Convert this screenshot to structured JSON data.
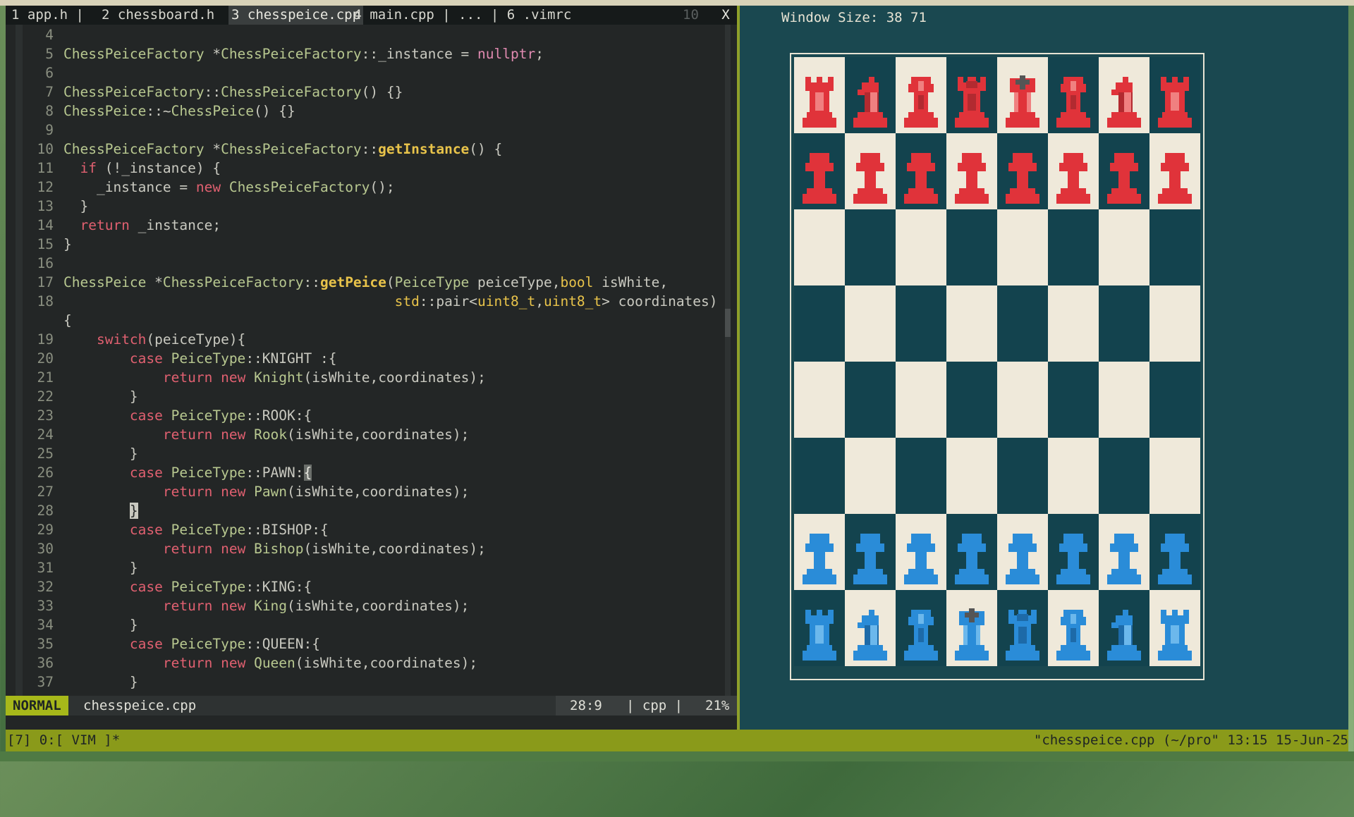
{
  "tabs": [
    {
      "label": "1 app.h | ",
      "active": false
    },
    {
      "label": "2 chessboard.h ",
      "active": false
    },
    {
      "label": "3 chesspeice.cpp",
      "active": true
    },
    {
      "label": " 4 main.cpp | ... | 6 .vimrc",
      "active": false
    }
  ],
  "tab_count": "10",
  "tab_close": "X",
  "editor": {
    "lines": [
      {
        "n": "4",
        "html": ""
      },
      {
        "n": "5",
        "html": "<span class=\"ty\">ChessPeiceFactory</span> *<span class=\"ty\">ChessPeiceFactory</span>::_instance = <span class=\"nu\">nullptr</span>;"
      },
      {
        "n": "6",
        "html": ""
      },
      {
        "n": "7",
        "html": "<span class=\"ty\">ChessPeiceFactory</span>::<span class=\"ty\">ChessPeiceFactory</span>() {}"
      },
      {
        "n": "8",
        "html": "<span class=\"ty\">ChessPeice</span>::~<span class=\"ty\">ChessPeice</span>() {}"
      },
      {
        "n": "9",
        "html": ""
      },
      {
        "n": "10",
        "html": "<span class=\"ty\">ChessPeiceFactory</span> *<span class=\"ty\">ChessPeiceFactory</span>::<span class=\"fn\">getInstance</span>() {"
      },
      {
        "n": "11",
        "html": "  <span class=\"kw\">if</span> (!_instance) {"
      },
      {
        "n": "12",
        "html": "    _instance = <span class=\"kw\">new</span> <span class=\"ty\">ChessPeiceFactory</span>();"
      },
      {
        "n": "13",
        "html": "  }"
      },
      {
        "n": "14",
        "html": "  <span class=\"kw\">return</span> _instance;"
      },
      {
        "n": "15",
        "html": "}"
      },
      {
        "n": "16",
        "html": ""
      },
      {
        "n": "17",
        "html": "<span class=\"ty\">ChessPeice</span> *<span class=\"ty\">ChessPeiceFactory</span>::<span class=\"fn\">getPeice</span>(<span class=\"ty\">PeiceType</span> peiceType,<span class=\"br\">bool</span> isWhite,"
      },
      {
        "n": "18",
        "html": "                                        <span class=\"br\">std</span>::pair&lt;<span class=\"br\">uint8_t</span>,<span class=\"br\">uint8_t</span>&gt; coordinates)"
      },
      {
        "n": "",
        "html": "{"
      },
      {
        "n": "19",
        "html": "    <span class=\"kw\">switch</span>(peiceType){"
      },
      {
        "n": "20",
        "html": "        <span class=\"kw\">case</span> <span class=\"ty\">PeiceType</span>::KNIGHT :{"
      },
      {
        "n": "21",
        "html": "            <span class=\"kw\">return</span> <span class=\"kw\">new</span> <span class=\"ty\">Knight</span>(isWhite,coordinates);"
      },
      {
        "n": "22",
        "html": "        }"
      },
      {
        "n": "23",
        "html": "        <span class=\"kw\">case</span> <span class=\"ty\">PeiceType</span>::ROOK:{"
      },
      {
        "n": "24",
        "html": "            <span class=\"kw\">return</span> <span class=\"kw\">new</span> <span class=\"ty\">Rook</span>(isWhite,coordinates);"
      },
      {
        "n": "25",
        "html": "        }"
      },
      {
        "n": "26",
        "html": "        <span class=\"kw\">case</span> <span class=\"ty\">PeiceType</span>::PAWN:<span class=\"cur2\">{</span>"
      },
      {
        "n": "27",
        "html": "            <span class=\"kw\">return</span> <span class=\"kw\">new</span> <span class=\"ty\">Pawn</span>(isWhite,coordinates);"
      },
      {
        "n": "28",
        "html": "        <span class=\"cur\">}</span>"
      },
      {
        "n": "29",
        "html": "        <span class=\"kw\">case</span> <span class=\"ty\">PeiceType</span>::BISHOP:{"
      },
      {
        "n": "30",
        "html": "            <span class=\"kw\">return</span> <span class=\"kw\">new</span> <span class=\"ty\">Bishop</span>(isWhite,coordinates);"
      },
      {
        "n": "31",
        "html": "        }"
      },
      {
        "n": "32",
        "html": "        <span class=\"kw\">case</span> <span class=\"ty\">PeiceType</span>::KING:{"
      },
      {
        "n": "33",
        "html": "            <span class=\"kw\">return</span> <span class=\"kw\">new</span> <span class=\"ty\">King</span>(isWhite,coordinates);"
      },
      {
        "n": "34",
        "html": "        }"
      },
      {
        "n": "35",
        "html": "        <span class=\"kw\">case</span> <span class=\"ty\">PeiceType</span>::QUEEN:{"
      },
      {
        "n": "36",
        "html": "            <span class=\"kw\">return</span> <span class=\"kw\">new</span> <span class=\"ty\">Queen</span>(isWhite,coordinates);"
      },
      {
        "n": "37",
        "html": "        }"
      }
    ]
  },
  "status": {
    "mode": "NORMAL",
    "filename": "chesspeice.cpp",
    "position": "28:9",
    "filetype": "| cpp |",
    "percent": "21%"
  },
  "game": {
    "window_size": "Window Size: 38 71",
    "colors": {
      "red": "#e0333a",
      "red_dark": "#b22a30",
      "red_light": "#f08080",
      "blue": "#2a8cd8",
      "blue_dark": "#1d6aa8",
      "blue_light": "#6cb8ec",
      "light_square": "#efe9da",
      "dark_square": "#13434e"
    },
    "board": [
      [
        "rook",
        "knight",
        "bishop",
        "queen",
        "king",
        "bishop",
        "knight",
        "rook"
      ],
      [
        "pawn",
        "pawn",
        "pawn",
        "pawn",
        "pawn",
        "pawn",
        "pawn",
        "pawn"
      ],
      [
        "",
        "",
        "",
        "",
        "",
        "",
        "",
        ""
      ],
      [
        "",
        "",
        "",
        "",
        "",
        "",
        "",
        ""
      ],
      [
        "",
        "",
        "",
        "",
        "",
        "",
        "",
        ""
      ],
      [
        "",
        "",
        "",
        "",
        "",
        "",
        "",
        ""
      ],
      [
        "pawn",
        "pawn",
        "pawn",
        "pawn",
        "pawn",
        "pawn",
        "pawn",
        "pawn"
      ],
      [
        "rook",
        "knight",
        "bishop",
        "king",
        "queen",
        "bishop",
        "knight",
        "rook"
      ]
    ],
    "piece_colors": [
      "red",
      "red",
      "",
      "",
      "",
      "",
      "blue",
      "blue"
    ]
  },
  "tmux": {
    "left": "[7] 0:[ VIM ]*",
    "right": "\"chesspeice.cpp (~/pro\" 13:15 15-Jun-25"
  }
}
